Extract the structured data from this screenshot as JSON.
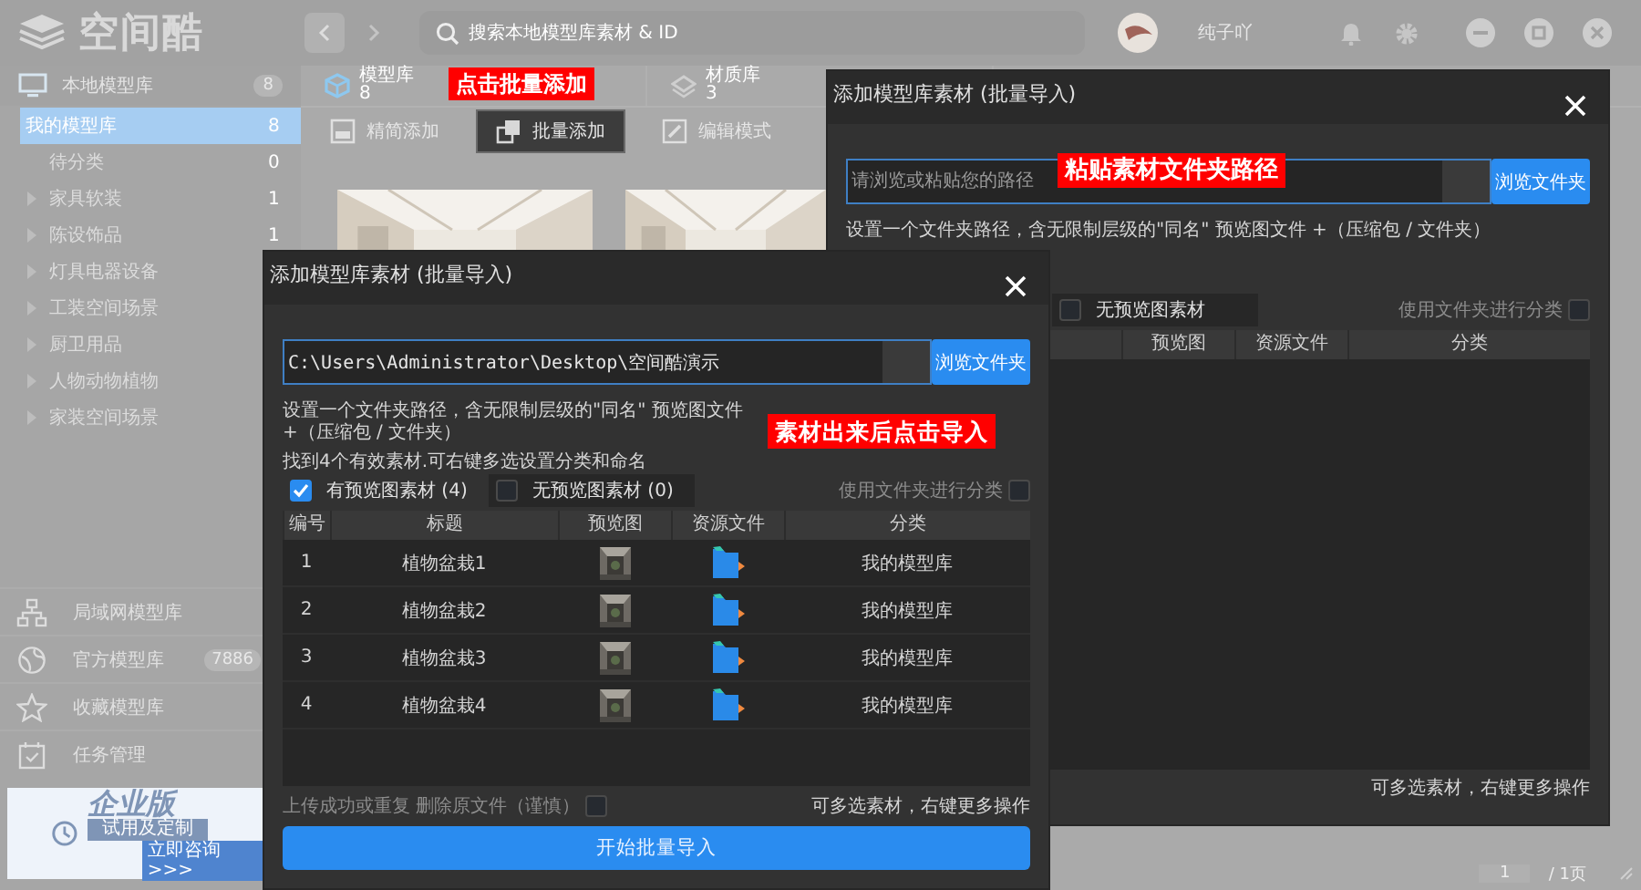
{
  "app": {
    "logo": "空间酷",
    "search": {
      "placeholder": "搜索本地模型库素材 & ID"
    },
    "user": "纯子吖",
    "sidebar": {
      "header": {
        "label": "本地模型库",
        "count": "8"
      },
      "items": [
        {
          "label": "我的模型库",
          "count": "8",
          "selected": true,
          "children": [
            {
              "label": "待分类",
              "count": "0",
              "selected": false,
              "expandable": false
            },
            {
              "label": "家具软装",
              "count": "1",
              "selected": false,
              "expandable": true
            },
            {
              "label": "陈设饰品",
              "count": "1",
              "selected": false,
              "expandable": true
            },
            {
              "label": "灯具电器设备",
              "selected": false,
              "expandable": true
            },
            {
              "label": "工装空间场景",
              "selected": false,
              "expandable": true
            },
            {
              "label": "厨卫用品",
              "selected": false,
              "expandable": true
            },
            {
              "label": "人物动物植物",
              "selected": false,
              "expandable": true
            },
            {
              "label": "家装空间场景",
              "selected": false,
              "expandable": true
            }
          ]
        }
      ],
      "libraries": [
        {
          "kind": "network",
          "label": "局域网模型库"
        },
        {
          "kind": "globe",
          "label": "官方模型库",
          "count": "7886"
        },
        {
          "kind": "star",
          "label": "收藏模型库"
        },
        {
          "kind": "task",
          "label": "任务管理"
        }
      ],
      "banner": {
        "title": "企业版",
        "subtitle": "试用及定制",
        "link": "立即咨询 >>>"
      }
    },
    "tabs": [
      {
        "label": "模型库",
        "count": "8",
        "selected": true
      },
      {
        "label": "材质库",
        "count": "3",
        "selected": false
      }
    ],
    "toolbar": [
      {
        "kind": "simple",
        "label": "精简添加",
        "selected": false
      },
      {
        "kind": "batch",
        "label": "批量添加",
        "selected": true
      },
      {
        "kind": "edit",
        "label": "编辑模式",
        "selected": false
      }
    ],
    "pagination": {
      "page": "1",
      "total": "/ 1页"
    }
  },
  "dialogs": [
    {
      "title": "添加模型库素材 (批量导入)",
      "path": {
        "placeholder": "请浏览或粘贴您的路径"
      },
      "browse": "浏览文件夹",
      "hint": "设置一个文件夹路径，含无限制层级的\"同名\" 预览图文件 +（压缩包 / 文件夹）",
      "filters": [
        {
          "label": "无预览图素材",
          "checked": false
        }
      ],
      "folder_option": {
        "label": "使用文件夹进行分类",
        "checked": false
      },
      "columns": [
        "预览图",
        "资源文件",
        "分类"
      ],
      "footer_right": "可多选素材，右键更多操作"
    },
    {
      "title": "添加模型库素材 (批量导入)",
      "path": {
        "value": "C:\\Users\\Administrator\\Desktop\\空间酷演示"
      },
      "browse": "浏览文件夹",
      "hint": "设置一个文件夹路径，含无限制层级的\"同名\" 预览图文件 +（压缩包 / 文件夹）",
      "found": "找到4个有效素材.可右键多选设置分类和命名",
      "filters": [
        {
          "label": "有预览图素材 (4)",
          "checked": true
        },
        {
          "label": "无预览图素材 (0)",
          "checked": false
        }
      ],
      "folder_option": {
        "label": "使用文件夹进行分类",
        "checked": false
      },
      "columns": [
        "编号",
        "标题",
        "预览图",
        "资源文件",
        "分类"
      ],
      "rows": [
        {
          "number": "1",
          "title": "植物盆栽1",
          "category": "我的模型库"
        },
        {
          "number": "2",
          "title": "植物盆栽2",
          "category": "我的模型库"
        },
        {
          "number": "3",
          "title": "植物盆栽3",
          "category": "我的模型库"
        },
        {
          "number": "4",
          "title": "植物盆栽4",
          "category": "我的模型库"
        }
      ],
      "delete_option": {
        "label": "上传成功或重复 删除原文件（谨慎）",
        "checked": false
      },
      "footer_right": "可多选素材，右键更多操作",
      "submit": "开始批量导入"
    }
  ],
  "annotations": [
    {
      "text": "点击批量添加"
    },
    {
      "text": "粘贴素材文件夹路径"
    },
    {
      "text": "素材出来后点击导入"
    }
  ]
}
